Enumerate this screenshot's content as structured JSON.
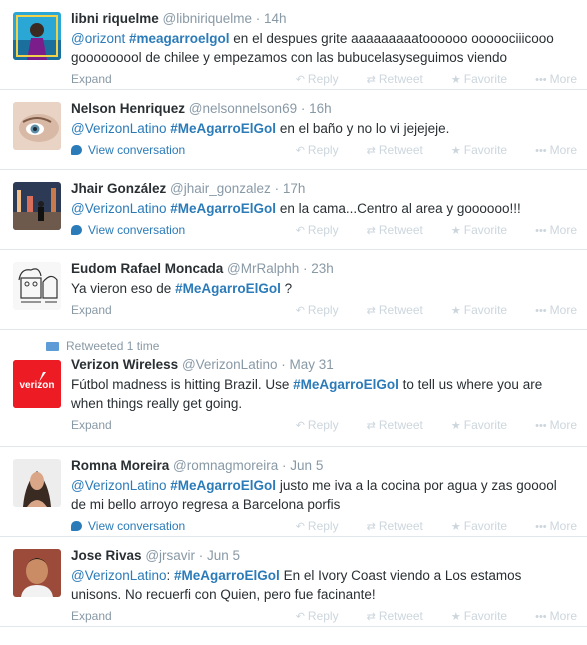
{
  "colors": {
    "link": "#2b7bb9",
    "muted": "#8899a6",
    "action": "#ccd6dd",
    "divider": "#e1e8ed"
  },
  "actions": {
    "reply": "Reply",
    "retweet": "Retweet",
    "favorite": "Favorite",
    "more": "More"
  },
  "tweets": [
    {
      "fullname": "libni riquelme",
      "handle": "@libniriquelme",
      "time": "14h",
      "segments": [
        {
          "t": "@orizont",
          "c": "hl"
        },
        {
          "t": " "
        },
        {
          "t": "#meagarroelgol",
          "c": "hlb"
        },
        {
          "t": " en el despues grite aaaaaaaaatoooooo ooooociiicooo gooooooool de chilee  y empezamos con las bubucelasyseguimos viendo"
        }
      ],
      "footer": "Expand",
      "footer_type": "expand"
    },
    {
      "fullname": "Nelson Henriquez",
      "handle": "@nelsonnelson69",
      "time": "16h",
      "segments": [
        {
          "t": "@VerizonLatino",
          "c": "hl"
        },
        {
          "t": " "
        },
        {
          "t": "#MeAgarroElGol",
          "c": "hlb"
        },
        {
          "t": " en el baño y no lo vi jejejeje."
        }
      ],
      "footer": "View conversation",
      "footer_type": "conversation"
    },
    {
      "fullname": "Jhair González",
      "handle": "@jhair_gonzalez",
      "time": "17h",
      "segments": [
        {
          "t": "@VerizonLatino",
          "c": "hl"
        },
        {
          "t": " "
        },
        {
          "t": "#MeAgarroElGol",
          "c": "hlb"
        },
        {
          "t": " en la cama...Centro al area y goooooo!!!"
        }
      ],
      "footer": "View conversation",
      "footer_type": "conversation"
    },
    {
      "fullname": "Eudom Rafael Moncada",
      "handle": "@MrRalphh",
      "time": "23h",
      "segments": [
        {
          "t": "Ya vieron eso de "
        },
        {
          "t": "#MeAgarroElGol",
          "c": "hlb"
        },
        {
          "t": " ?"
        }
      ],
      "footer": "Expand",
      "footer_type": "expand"
    },
    {
      "context": "Retweeted 1 time",
      "fullname": "Verizon Wireless",
      "handle": "@VerizonLatino",
      "time": "May 31",
      "avatar_text": "verizon",
      "segments": [
        {
          "t": "Fútbol madness is hitting Brazil. Use "
        },
        {
          "t": "#MeAgarroElGol",
          "c": "hlb"
        },
        {
          "t": " to tell us where you are when things really get going."
        }
      ],
      "footer": "Expand",
      "footer_type": "expand"
    },
    {
      "fullname": "Romna Moreira",
      "handle": "@romnagmoreira",
      "time": "Jun 5",
      "segments": [
        {
          "t": "@VerizonLatino",
          "c": "hl"
        },
        {
          "t": " "
        },
        {
          "t": "#MeAgarroElGol",
          "c": "hlb"
        },
        {
          "t": " justo me iva a la cocina por agua y zas gooool de mi bello arroyo regresa a Barcelona porfis"
        }
      ],
      "footer": "View conversation",
      "footer_type": "conversation"
    },
    {
      "fullname": "Jose Rivas",
      "handle": "@jrsavir",
      "time": "Jun 5",
      "segments": [
        {
          "t": "@VerizonLatino",
          "c": "hl"
        },
        {
          "t": ": "
        },
        {
          "t": "#MeAgarroElGol",
          "c": "hlb"
        },
        {
          "t": " En el Ivory Coast viendo a Los estamos unisons.  No recuerfi con Quien, pero fue facinante!"
        }
      ],
      "footer": "Expand",
      "footer_type": "expand"
    }
  ]
}
